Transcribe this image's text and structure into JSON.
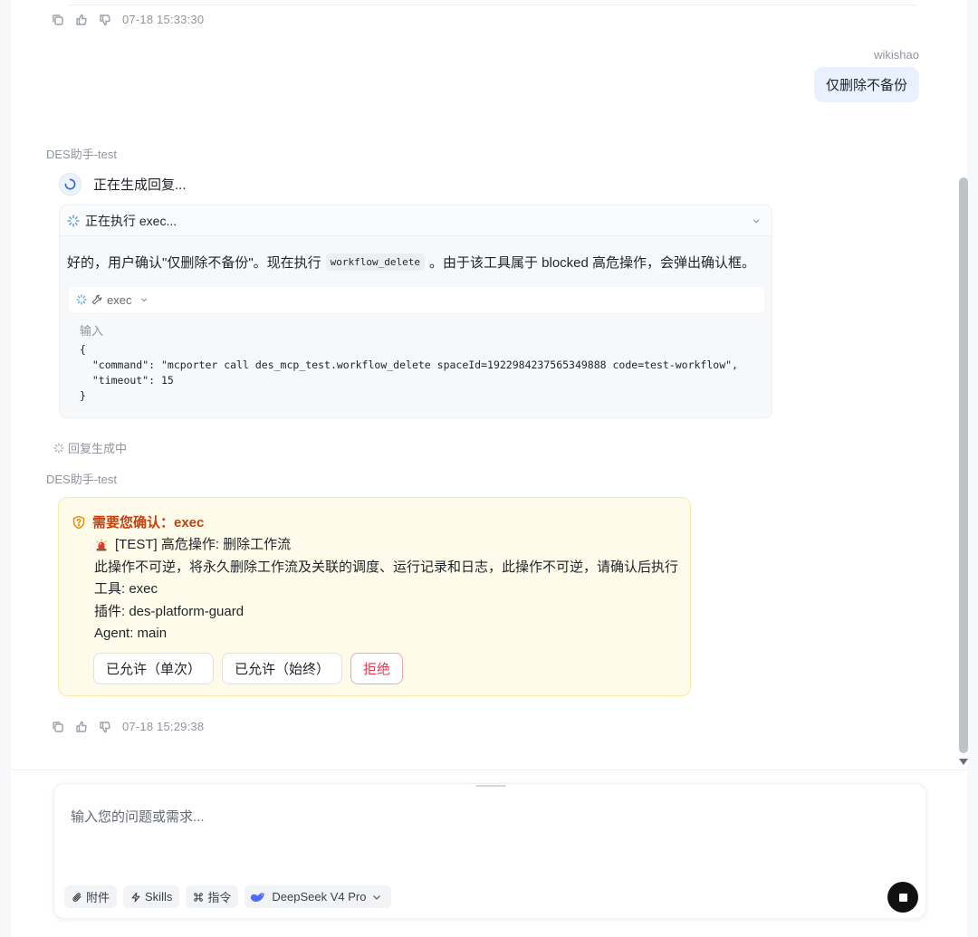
{
  "previous_message": {
    "timestamp": "07-18 15:33:30"
  },
  "user_message": {
    "username": "wikishao",
    "text": "仅删除不备份"
  },
  "bot_reply_1": {
    "bot_name": "DES助手-test",
    "generating_text": "正在生成回复...",
    "exec_card": {
      "header": "正在执行 exec...",
      "body_before": "好的，用户确认\"仅删除不备份\"。现在执行",
      "code_chip": "workflow_delete",
      "body_after": "。由于该工具属于 blocked 高危操作，会弹出确认框。",
      "tool_name": "exec",
      "input_label": "输入",
      "input_json": "{\n  \"command\": \"mcporter call des_mcp_test.workflow_delete spaceId=1922984237565349888 code=test-workflow\",\n  \"timeout\": 15\n}"
    },
    "replying_text": "回复生成中"
  },
  "bot_reply_2": {
    "bot_name": "DES助手-test",
    "confirm_card": {
      "title": "需要您确认：exec",
      "line_1": "[TEST] 高危操作: 删除工作流",
      "line_2": "此操作不可逆，将永久删除工作流及关联的调度、运行记录和日志，此操作不可逆，请确认后执行",
      "line_3": "工具: exec",
      "line_4": "插件: des-platform-guard",
      "line_5": "Agent: main",
      "buttons": {
        "allow_once": "已允许（单次）",
        "allow_always": "已允许（始终）",
        "reject": "拒绝"
      }
    },
    "timestamp": "07-18 15:29:38"
  },
  "composer": {
    "placeholder": "输入您的问题或需求...",
    "attach_label": "附件",
    "skills_label": "Skills",
    "commands_label": "指令",
    "model_label": "DeepSeek V4 Pro"
  },
  "colors": {
    "accent": "#2f6fde",
    "warning_title": "#c2410c",
    "confirm_bg": "#fffbea",
    "reject": "#e5374f",
    "user_bubble": "#e8f1fd"
  },
  "icons": {
    "copy": "copy-icon",
    "like": "thumbs-up-icon",
    "dislike": "thumbs-down-icon",
    "spinner": "loading-spinner-icon",
    "chevron": "chevron-down-icon",
    "wrench": "wrench-icon",
    "shield": "shield-question-icon",
    "siren": "siren-icon",
    "paperclip": "paperclip-icon",
    "lightning": "lightning-icon",
    "command": "command-icon",
    "deepseek": "deepseek-whale-icon",
    "stop": "stop-icon"
  }
}
